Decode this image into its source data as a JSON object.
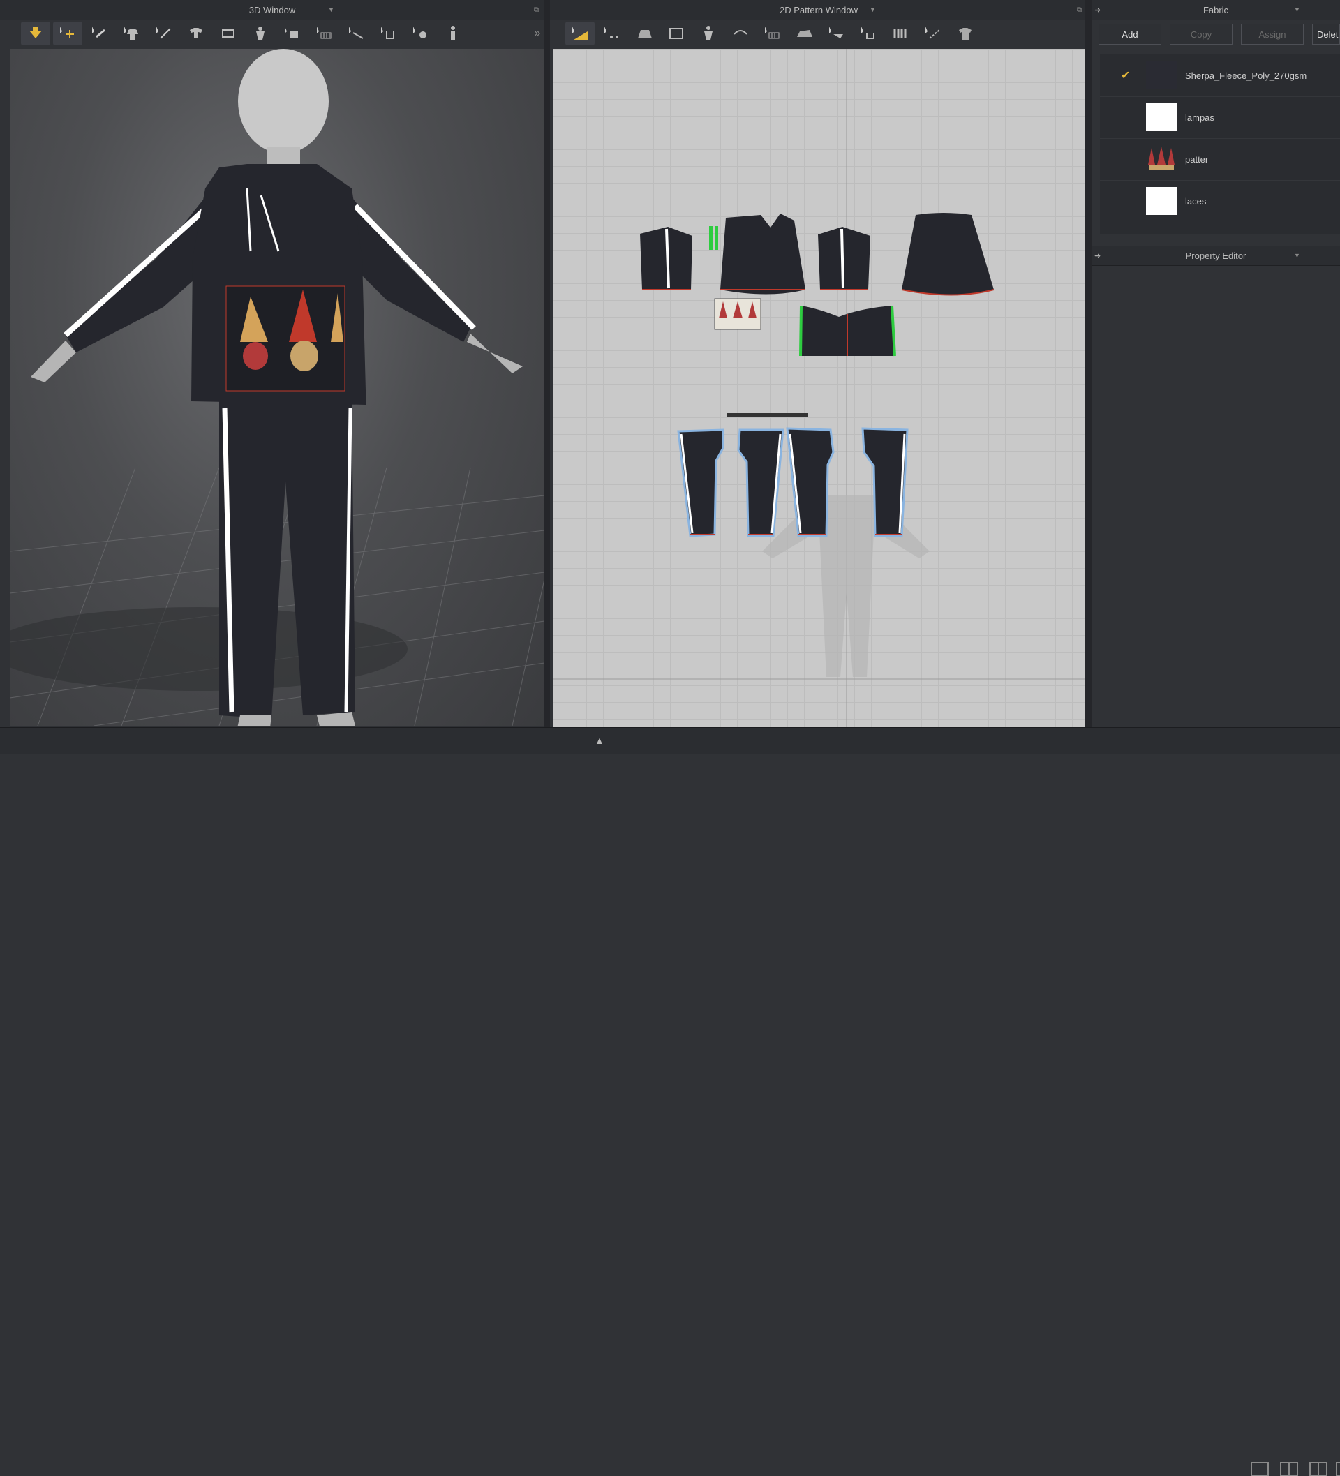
{
  "window3d": {
    "title": "3D Window",
    "toolbar_icons": [
      "select-move-icon",
      "transform-icon",
      "fold-arrange-icon",
      "garment-icon",
      "seam-line-icon",
      "avatar-arrange-icon",
      "tack-icon",
      "pin-icon",
      "steam-icon",
      "fold-icon",
      "cut-icon",
      "measure-icon",
      "show-icon",
      "avatar-icon"
    ],
    "sub_icons": [
      "fabric-render-icon",
      "garment-view-icon",
      "arrange-point-icon",
      "avatar-view-icon",
      "texture-icon",
      "shading-icon",
      "skin-icon",
      "globe-icon",
      "export-icon"
    ]
  },
  "window2d": {
    "title": "2D Pattern Window",
    "toolbar_icons": [
      "transform-pattern-icon",
      "edit-point-icon",
      "polygon-icon",
      "rectangle-icon",
      "trace-icon",
      "sewing-icon",
      "segment-sew-icon",
      "iron-icon",
      "free-sew-icon",
      "check-sew-icon",
      "pleat-icon",
      "line-icon",
      "shirt-icon"
    ],
    "sub_icons": [
      "ruler-icon",
      "garment-show-icon",
      "info-icon",
      "texture-2d-icon",
      "lock-icon",
      "export-2d-icon"
    ]
  },
  "fabric": {
    "title": "Fabric",
    "buttons": {
      "add": "Add",
      "copy": "Copy",
      "assign": "Assign",
      "delete": "Delet"
    },
    "items": [
      {
        "name": "Sherpa_Fleece_Poly_270gsm",
        "selected": true,
        "swatch": "#2a2b33"
      },
      {
        "name": "lampas",
        "selected": false,
        "swatch": "#ffffff"
      },
      {
        "name": "patter",
        "selected": false,
        "swatch": "gnome-pattern"
      },
      {
        "name": "laces",
        "selected": false,
        "swatch": "#ffffff"
      }
    ]
  },
  "property_editor": {
    "title": "Property Editor"
  },
  "colors": {
    "accent": "#e5b83a",
    "garment": "#25262d",
    "stripe": "#ffffff",
    "seam": "#c0392b",
    "pattern_outline": "#8ab4e0",
    "green": "#2ecc40"
  }
}
